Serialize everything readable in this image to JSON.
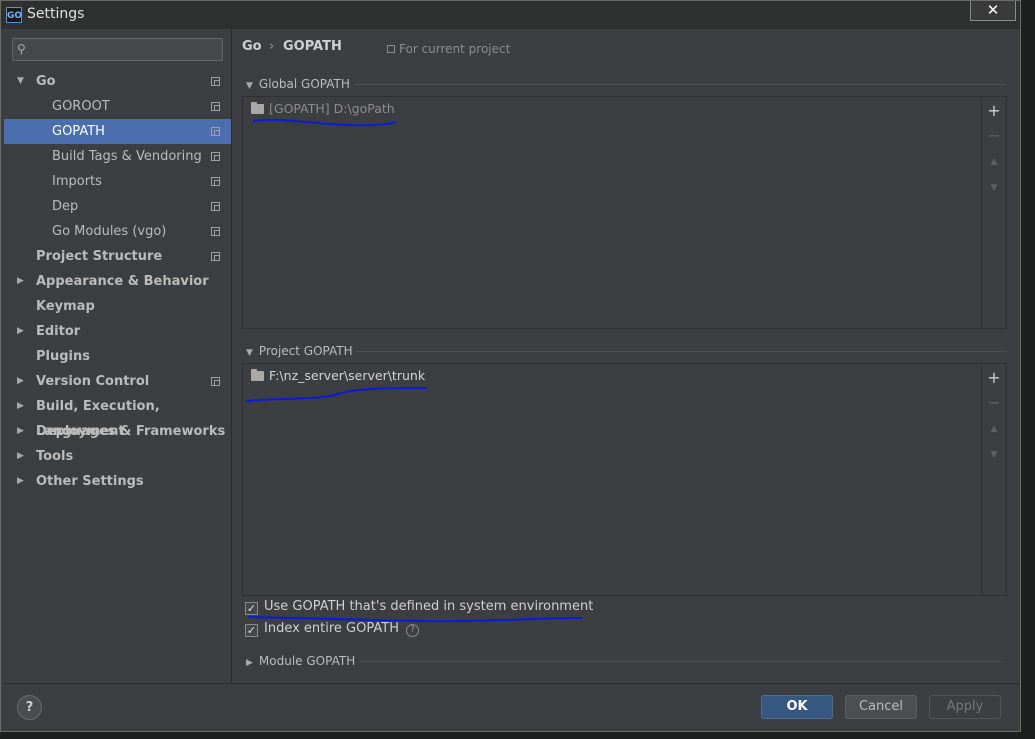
{
  "window": {
    "title": "Settings",
    "app_logo": "GO"
  },
  "search": {
    "placeholder": ""
  },
  "tree": [
    {
      "label": "Go",
      "level": 0,
      "expanded": true,
      "bold": true
    },
    {
      "label": "GOROOT",
      "level": 1
    },
    {
      "label": "GOPATH",
      "level": 1,
      "selected": true
    },
    {
      "label": "Build Tags & Vendoring",
      "level": 1
    },
    {
      "label": "Imports",
      "level": 1
    },
    {
      "label": "Dep",
      "level": 1
    },
    {
      "label": "Go Modules (vgo)",
      "level": 1
    },
    {
      "label": "Project Structure",
      "level": 0,
      "bold": true
    },
    {
      "label": "Appearance & Behavior",
      "level": 0,
      "collapsed": true,
      "bold": true
    },
    {
      "label": "Keymap",
      "level": 0,
      "bold": true
    },
    {
      "label": "Editor",
      "level": 0,
      "collapsed": true,
      "bold": true
    },
    {
      "label": "Plugins",
      "level": 0,
      "bold": true
    },
    {
      "label": "Version Control",
      "level": 0,
      "collapsed": true,
      "bold": true
    },
    {
      "label": "Build, Execution, Deployment",
      "level": 0,
      "collapsed": true,
      "bold": true
    },
    {
      "label": "Languages & Frameworks",
      "level": 0,
      "collapsed": true,
      "bold": true
    },
    {
      "label": "Tools",
      "level": 0,
      "collapsed": true,
      "bold": true
    },
    {
      "label": "Other Settings",
      "level": 0,
      "collapsed": true,
      "bold": true
    }
  ],
  "breadcrumb": {
    "parent": "Go",
    "separator": "›",
    "current": "GOPATH",
    "scope": "For current project"
  },
  "global_gopath": {
    "title": "Global GOPATH",
    "entry_prefix": "[GOPATH]",
    "entry_path": "D:\\goPath"
  },
  "project_gopath": {
    "title": "Project GOPATH",
    "entry_path": "F:\\nz_server\\server\\trunk"
  },
  "toolbar": {
    "add": "+",
    "remove": "−",
    "up": "▲",
    "down": "▼"
  },
  "options": {
    "use_system_gopath": {
      "label": "Use GOPATH that's defined in system environment",
      "checked": true
    },
    "index_entire_gopath": {
      "label": "Index entire GOPATH",
      "checked": true
    }
  },
  "module_gopath": {
    "title": "Module GOPATH"
  },
  "buttons": {
    "help": "?",
    "ok": "OK",
    "cancel": "Cancel",
    "apply": "Apply"
  },
  "colors": {
    "selection": "#4b6eaf",
    "primary_button": "#365880",
    "annotation_ink": "#0a1adf"
  }
}
